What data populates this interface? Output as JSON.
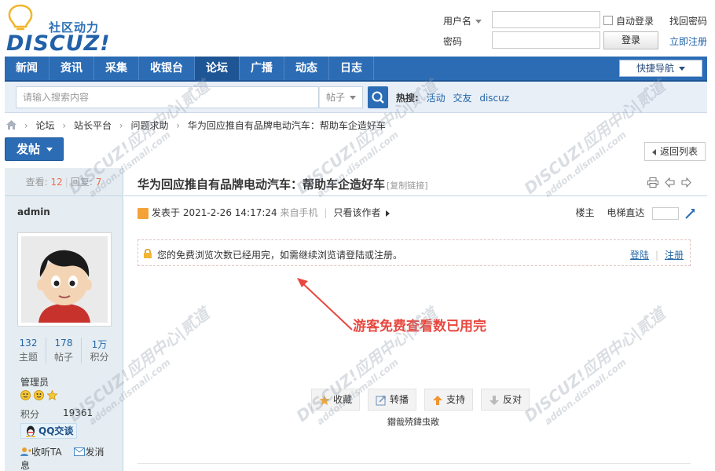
{
  "header": {
    "slogan": "社区动力",
    "logo_word": "DISCUZ!",
    "login": {
      "username_label": "用户名",
      "password_label": "密码",
      "auto_login": "自动登录",
      "login_button": "登录",
      "find_password": "找回密码",
      "register": "立即注册"
    }
  },
  "nav": {
    "items": [
      {
        "label": "新闻"
      },
      {
        "label": "资讯"
      },
      {
        "label": "采集"
      },
      {
        "label": "收银台"
      },
      {
        "label": "论坛",
        "active": true
      },
      {
        "label": "广播"
      },
      {
        "label": "动态"
      },
      {
        "label": "日志"
      }
    ],
    "quick_nav": "快捷导航"
  },
  "search": {
    "placeholder": "请输入搜索内容",
    "scope": "帖子",
    "hot_label": "热搜:",
    "hot": [
      "活动",
      "交友",
      "discuz"
    ]
  },
  "breadcrumb": [
    "论坛",
    "站长平台",
    "问题求助",
    "华为回应推自有品牌电动汽车：帮助车企造好车"
  ],
  "post_button": "发帖",
  "back_button": "返回列表",
  "sidebar": {
    "views_label": "查看:",
    "views": "12",
    "replies_label": "回复:",
    "replies": "7",
    "username": "admin",
    "counts": [
      {
        "value": "132",
        "label": "主题"
      },
      {
        "value": "178",
        "label": "帖子"
      },
      {
        "value": "1万",
        "label": "积分"
      }
    ],
    "role": "管理员",
    "score_label": "积分",
    "score": "19361",
    "qq": "QQ交谈",
    "follow": "收听TA",
    "message": "发消息"
  },
  "thread": {
    "title": "华为回应推自有品牌电动汽车：帮助车企造好车",
    "copy_link": "[复制链接]",
    "posted_prefix": "发表于",
    "posted_at": "2021-2-26 14:17:24",
    "source": "来自手机",
    "only_author": "只看该作者",
    "floor": "楼主",
    "elevator": "电梯直达",
    "lock_message": "您的免费浏览次数已经用完，如需继续浏览请登陆或注册。",
    "login_link": "登陆",
    "register_link": "注册",
    "annotation": "游客免费查看数已用完",
    "actions": [
      "收藏",
      "转播",
      "支持",
      "反对"
    ],
    "garbled": "鐟戠殑鍏虫敞"
  },
  "watermark": {
    "brand": "DISCUZ!应用中心|贰道",
    "domain": "addon.dismall.com"
  },
  "colors": {
    "nav_blue": "#2b6cb5",
    "link_blue": "#2366a8",
    "sidebar_bg": "#e5edf2",
    "annotation_red": "#e8473f"
  }
}
